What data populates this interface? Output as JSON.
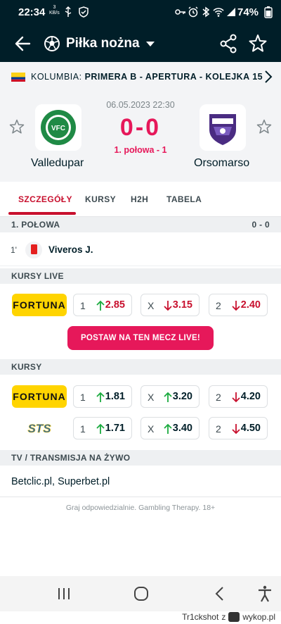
{
  "status_bar": {
    "time": "22:34",
    "speed_value": "3",
    "speed_unit": "KB/s",
    "battery": "74%"
  },
  "app_bar": {
    "title": "Piłka nożna",
    "icons": [
      "back-arrow-icon",
      "soccer-ball-icon",
      "dropdown-caret-icon",
      "share-icon",
      "star-icon"
    ]
  },
  "league": {
    "country": "KOLUMBIA:",
    "name": "PRIMERA B - APERTURA - KOLEJKA 15",
    "flag_colors": [
      "#fcd116",
      "#003893",
      "#ce1126"
    ]
  },
  "match": {
    "datetime": "06.05.2023 22:30",
    "score": "0-0",
    "stage": "1. połowa - 1",
    "home": {
      "name": "Valledupar",
      "logo_text": "VFC"
    },
    "away": {
      "name": "Orsomarso"
    }
  },
  "tabs": [
    "SZCZEGÓŁY",
    "KURSY",
    "H2H",
    "TABELA"
  ],
  "incidents_section": {
    "title": "1. POŁOWA",
    "score": "0 - 0",
    "items": [
      {
        "minute": "1'",
        "type": "red-card",
        "player": "Viveros J."
      }
    ]
  },
  "live_odds": {
    "title": "KURSY LIVE",
    "bookmaker": "FORTUNA",
    "odds": [
      {
        "label": "1",
        "value": "2.85",
        "trend": "up"
      },
      {
        "label": "X",
        "value": "3.15",
        "trend": "down"
      },
      {
        "label": "2",
        "value": "2.40",
        "trend": "down"
      }
    ],
    "cta": "POSTAW NA TEN MECZ LIVE!"
  },
  "prematch_odds": {
    "title": "KURSY",
    "rows": [
      {
        "bookmaker": "FORTUNA",
        "odds": [
          {
            "label": "1",
            "value": "1.81",
            "trend": "up"
          },
          {
            "label": "X",
            "value": "3.20",
            "trend": "up"
          },
          {
            "label": "2",
            "value": "4.20",
            "trend": "down"
          }
        ]
      },
      {
        "bookmaker": "STS",
        "odds": [
          {
            "label": "1",
            "value": "1.71",
            "trend": "up"
          },
          {
            "label": "X",
            "value": "3.40",
            "trend": "up"
          },
          {
            "label": "2",
            "value": "4.50",
            "trend": "down"
          }
        ]
      }
    ]
  },
  "tv": {
    "title": "TV / TRANSMISJA NA ŻYWO",
    "channels": "Betclic.pl, Superbet.pl"
  },
  "responsible": "Graj odpowiedzialnie. Gambling Therapy. 18+",
  "credit": {
    "user": "Tr1ckshot",
    "joiner": "z",
    "site": "wykop.pl"
  },
  "colors": {
    "dark": "#001e28",
    "accent": "#e6185a",
    "up": "#1bab3f",
    "down": "#c8102e",
    "fortuna": "#ffd400"
  }
}
